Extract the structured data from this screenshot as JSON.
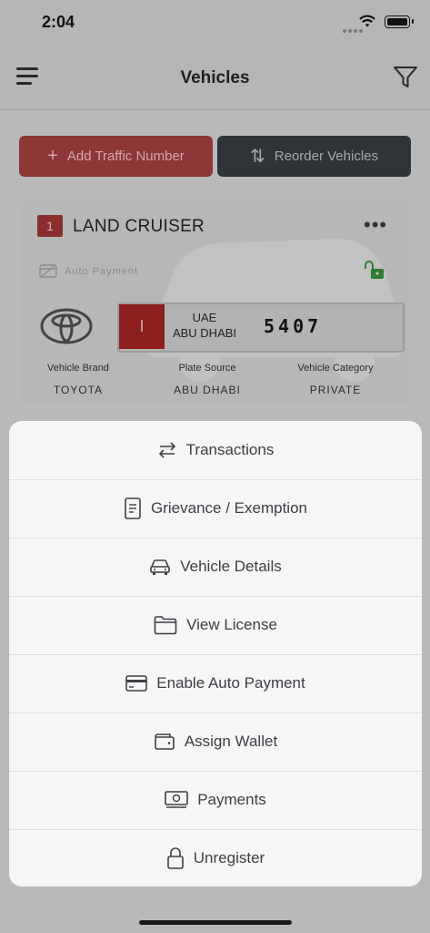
{
  "status_bar": {
    "time": "2:04"
  },
  "nav": {
    "title": "Vehicles"
  },
  "actions": {
    "add_label": "Add Traffic Number",
    "reorder_label": "Reorder Vehicles"
  },
  "vehicle": {
    "index": "1",
    "name": "LAND CRUISER",
    "auto_payment_label": "Auto Payment",
    "plate": {
      "code": "I",
      "country": "UAE",
      "emirate": "ABU DHABI",
      "number": "5407"
    },
    "info": [
      {
        "label": "Vehicle Brand",
        "value": "TOYOTA"
      },
      {
        "label": "Plate Source",
        "value": "ABU DHABI"
      },
      {
        "label": "Vehicle Category",
        "value": "PRIVATE"
      }
    ]
  },
  "sheet": {
    "items": [
      {
        "label": "Transactions",
        "icon": "swap-arrows-icon"
      },
      {
        "label": "Grievance / Exemption",
        "icon": "document-icon"
      },
      {
        "label": "Vehicle Details",
        "icon": "car-icon"
      },
      {
        "label": "View License",
        "icon": "folder-icon"
      },
      {
        "label": "Enable Auto Payment",
        "icon": "card-icon"
      },
      {
        "label": "Assign Wallet",
        "icon": "wallet-icon"
      },
      {
        "label": "Payments",
        "icon": "cash-icon"
      },
      {
        "label": "Unregister",
        "icon": "lock-icon"
      }
    ]
  },
  "colors": {
    "accent_red": "#c0392b",
    "dark_button": "#3a4246",
    "sheet_bg": "#f6f6f6",
    "text": "#3b3f45"
  }
}
